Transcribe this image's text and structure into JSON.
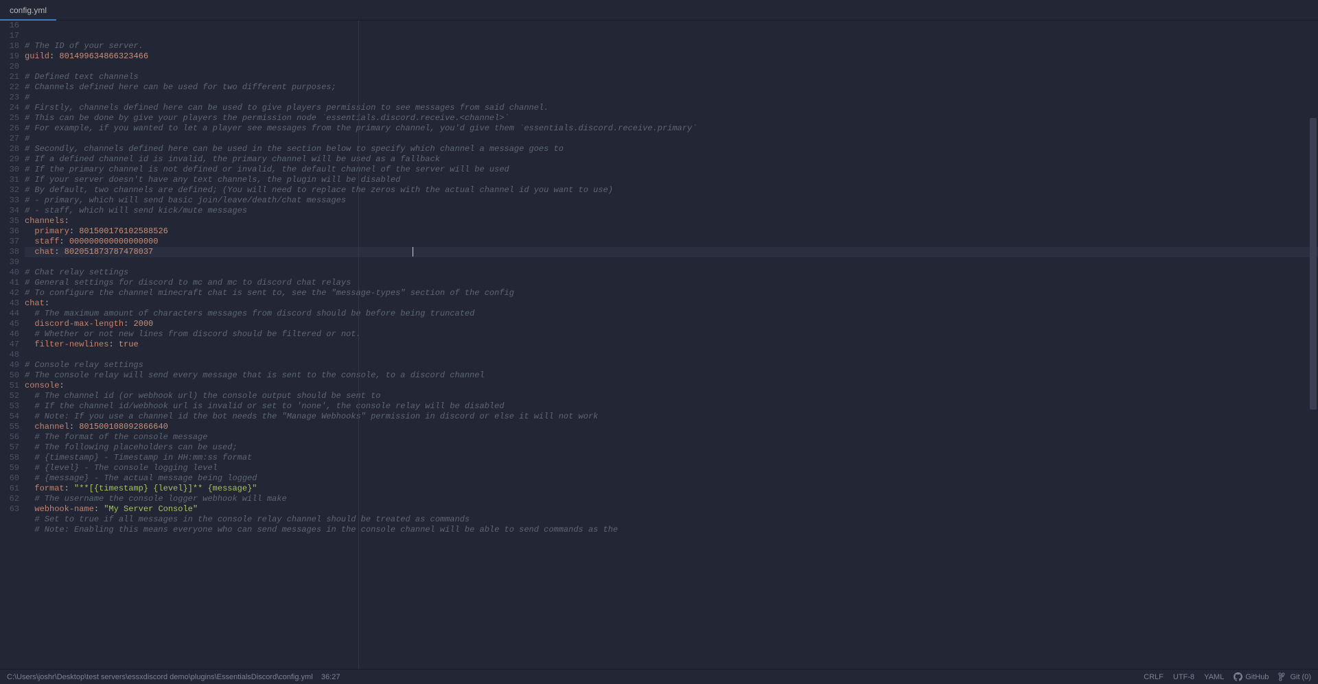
{
  "tab": {
    "filename": "config.yml"
  },
  "statusbar": {
    "path": "C:\\Users\\joshr\\Desktop\\test servers\\essxdiscord demo\\plugins\\EssentialsDiscord\\config.yml",
    "cursor_pos": "36:27",
    "line_sep": "CRLF",
    "encoding": "UTF-8",
    "lang": "YAML",
    "github": "GitHub",
    "git": "Git (0)"
  },
  "lines": [
    {
      "n": 16,
      "ind": 0,
      "tokens": [
        {
          "t": "# The ID of your server.",
          "cls": "c"
        }
      ]
    },
    {
      "n": 17,
      "ind": 0,
      "tokens": [
        {
          "t": "guild",
          "cls": "k"
        },
        {
          "t": ": ",
          "cls": "p"
        },
        {
          "t": "801499634866323466",
          "cls": "n"
        }
      ]
    },
    {
      "n": 18,
      "ind": 0,
      "tokens": []
    },
    {
      "n": 19,
      "ind": 0,
      "tokens": [
        {
          "t": "# Defined text channels",
          "cls": "c"
        }
      ]
    },
    {
      "n": 20,
      "ind": 0,
      "tokens": [
        {
          "t": "# Channels defined here can be used for two different purposes;",
          "cls": "c"
        }
      ]
    },
    {
      "n": 21,
      "ind": 0,
      "tokens": [
        {
          "t": "#",
          "cls": "c"
        }
      ]
    },
    {
      "n": 22,
      "ind": 0,
      "tokens": [
        {
          "t": "# Firstly, channels defined here can be used to give players permission to see messages from said channel.",
          "cls": "c"
        }
      ]
    },
    {
      "n": 23,
      "ind": 0,
      "tokens": [
        {
          "t": "# This can be done by give your players the permission node `essentials.discord.receive.<channel>`",
          "cls": "c"
        }
      ]
    },
    {
      "n": 24,
      "ind": 0,
      "tokens": [
        {
          "t": "# For example, if you wanted to let a player see messages from the primary channel, you'd give them `essentials.discord.receive.primary`",
          "cls": "c"
        }
      ]
    },
    {
      "n": 25,
      "ind": 0,
      "tokens": [
        {
          "t": "#",
          "cls": "c"
        }
      ]
    },
    {
      "n": 26,
      "ind": 0,
      "tokens": [
        {
          "t": "# Secondly, channels defined here can be used in the section below to specify which channel a message goes to",
          "cls": "c"
        }
      ]
    },
    {
      "n": 27,
      "ind": 0,
      "tokens": [
        {
          "t": "# If a defined channel id is invalid, the primary channel will be used as a fallback",
          "cls": "c"
        }
      ]
    },
    {
      "n": 28,
      "ind": 0,
      "tokens": [
        {
          "t": "# If the primary channel is not defined or invalid, the default channel of the server will be used",
          "cls": "c"
        }
      ]
    },
    {
      "n": 29,
      "ind": 0,
      "tokens": [
        {
          "t": "# If your server doesn't have any text channels, the plugin will be disabled",
          "cls": "c"
        }
      ]
    },
    {
      "n": 30,
      "ind": 0,
      "tokens": [
        {
          "t": "# By default, two channels are defined; (You will need to replace the zeros with the actual channel id you want to use)",
          "cls": "c"
        }
      ]
    },
    {
      "n": 31,
      "ind": 0,
      "tokens": [
        {
          "t": "# - primary, which will send basic join/leave/death/chat messages",
          "cls": "c"
        }
      ]
    },
    {
      "n": 32,
      "ind": 0,
      "tokens": [
        {
          "t": "# - staff, which will send kick/mute messages",
          "cls": "c"
        }
      ]
    },
    {
      "n": 33,
      "ind": 0,
      "tokens": [
        {
          "t": "channels",
          "cls": "k"
        },
        {
          "t": ":",
          "cls": "p"
        }
      ]
    },
    {
      "n": 34,
      "ind": 1,
      "tokens": [
        {
          "t": "primary",
          "cls": "k"
        },
        {
          "t": ": ",
          "cls": "p"
        },
        {
          "t": "801500176102588526",
          "cls": "n"
        }
      ]
    },
    {
      "n": 35,
      "ind": 1,
      "tokens": [
        {
          "t": "staff",
          "cls": "k"
        },
        {
          "t": ": ",
          "cls": "p"
        },
        {
          "t": "000000000000000000",
          "cls": "n"
        }
      ]
    },
    {
      "n": 36,
      "ind": 1,
      "current": true,
      "tokens": [
        {
          "t": "chat",
          "cls": "k"
        },
        {
          "t": ": ",
          "cls": "p"
        },
        {
          "t": "802051873787478037",
          "cls": "n"
        }
      ]
    },
    {
      "n": 37,
      "ind": 0,
      "tokens": []
    },
    {
      "n": 38,
      "ind": 0,
      "tokens": [
        {
          "t": "# Chat relay settings",
          "cls": "c"
        }
      ]
    },
    {
      "n": 39,
      "ind": 0,
      "tokens": [
        {
          "t": "# General settings for discord to mc and mc to discord chat relays",
          "cls": "c"
        }
      ]
    },
    {
      "n": 40,
      "ind": 0,
      "tokens": [
        {
          "t": "# To configure the channel minecraft chat is sent to, see the \"message-types\" section of the config",
          "cls": "c"
        }
      ]
    },
    {
      "n": 41,
      "ind": 0,
      "tokens": [
        {
          "t": "chat",
          "cls": "k"
        },
        {
          "t": ":",
          "cls": "p"
        }
      ]
    },
    {
      "n": 42,
      "ind": 1,
      "tokens": [
        {
          "t": "# The maximum amount of characters messages from discord should be before being truncated",
          "cls": "c"
        }
      ]
    },
    {
      "n": 43,
      "ind": 1,
      "tokens": [
        {
          "t": "discord-max-length",
          "cls": "k"
        },
        {
          "t": ": ",
          "cls": "p"
        },
        {
          "t": "2000",
          "cls": "n"
        }
      ]
    },
    {
      "n": 44,
      "ind": 1,
      "tokens": [
        {
          "t": "# Whether or not new lines from discord should be filtered or not.",
          "cls": "c"
        }
      ]
    },
    {
      "n": 45,
      "ind": 1,
      "tokens": [
        {
          "t": "filter-newlines",
          "cls": "k"
        },
        {
          "t": ": ",
          "cls": "p"
        },
        {
          "t": "true",
          "cls": "b"
        }
      ]
    },
    {
      "n": 46,
      "ind": 0,
      "tokens": []
    },
    {
      "n": 47,
      "ind": 0,
      "tokens": [
        {
          "t": "# Console relay settings",
          "cls": "c"
        }
      ]
    },
    {
      "n": 48,
      "ind": 0,
      "tokens": [
        {
          "t": "# The console relay will send every message that is sent to the console, to a discord channel",
          "cls": "c"
        }
      ]
    },
    {
      "n": 49,
      "ind": 0,
      "tokens": [
        {
          "t": "console",
          "cls": "k"
        },
        {
          "t": ":",
          "cls": "p"
        }
      ]
    },
    {
      "n": 50,
      "ind": 1,
      "tokens": [
        {
          "t": "# The channel id (or webhook url) the console output should be sent to",
          "cls": "c"
        }
      ]
    },
    {
      "n": 51,
      "ind": 1,
      "tokens": [
        {
          "t": "# If the channel id/webhook url is invalid or set to 'none', the console relay will be disabled",
          "cls": "c"
        }
      ]
    },
    {
      "n": 52,
      "ind": 1,
      "tokens": [
        {
          "t": "# Note: If you use a channel id the bot needs the \"Manage Webhooks\" permission in discord or else it will not work",
          "cls": "c"
        }
      ]
    },
    {
      "n": 53,
      "ind": 1,
      "tokens": [
        {
          "t": "channel",
          "cls": "k"
        },
        {
          "t": ": ",
          "cls": "p"
        },
        {
          "t": "801500108092866640",
          "cls": "n"
        }
      ]
    },
    {
      "n": 54,
      "ind": 1,
      "tokens": [
        {
          "t": "# The format of the console message",
          "cls": "c"
        }
      ]
    },
    {
      "n": 55,
      "ind": 1,
      "tokens": [
        {
          "t": "# The following placeholders can be used;",
          "cls": "c"
        }
      ]
    },
    {
      "n": 56,
      "ind": 1,
      "tokens": [
        {
          "t": "# {timestamp} - Timestamp in HH:mm:ss format",
          "cls": "c"
        }
      ]
    },
    {
      "n": 57,
      "ind": 1,
      "tokens": [
        {
          "t": "# {level} - The console logging level",
          "cls": "c"
        }
      ]
    },
    {
      "n": 58,
      "ind": 1,
      "tokens": [
        {
          "t": "# {message} - The actual message being logged",
          "cls": "c"
        }
      ]
    },
    {
      "n": 59,
      "ind": 1,
      "tokens": [
        {
          "t": "format",
          "cls": "k"
        },
        {
          "t": ": ",
          "cls": "p"
        },
        {
          "t": "\"**[{timestamp} {level}]** {message}\"",
          "cls": "s"
        }
      ]
    },
    {
      "n": 60,
      "ind": 1,
      "tokens": [
        {
          "t": "# The username the console logger webhook will make",
          "cls": "c"
        }
      ]
    },
    {
      "n": 61,
      "ind": 1,
      "tokens": [
        {
          "t": "webhook-name",
          "cls": "k"
        },
        {
          "t": ": ",
          "cls": "p"
        },
        {
          "t": "\"My Server Console\"",
          "cls": "s"
        }
      ]
    },
    {
      "n": 62,
      "ind": 1,
      "tokens": [
        {
          "t": "# Set to true if all messages in the console relay channel should be treated as commands",
          "cls": "c"
        }
      ]
    },
    {
      "n": 63,
      "ind": 1,
      "tokens": [
        {
          "t": "# Note: Enabling this means everyone who can send messages in the console channel will be able to send commands as the",
          "cls": "c"
        }
      ]
    }
  ]
}
